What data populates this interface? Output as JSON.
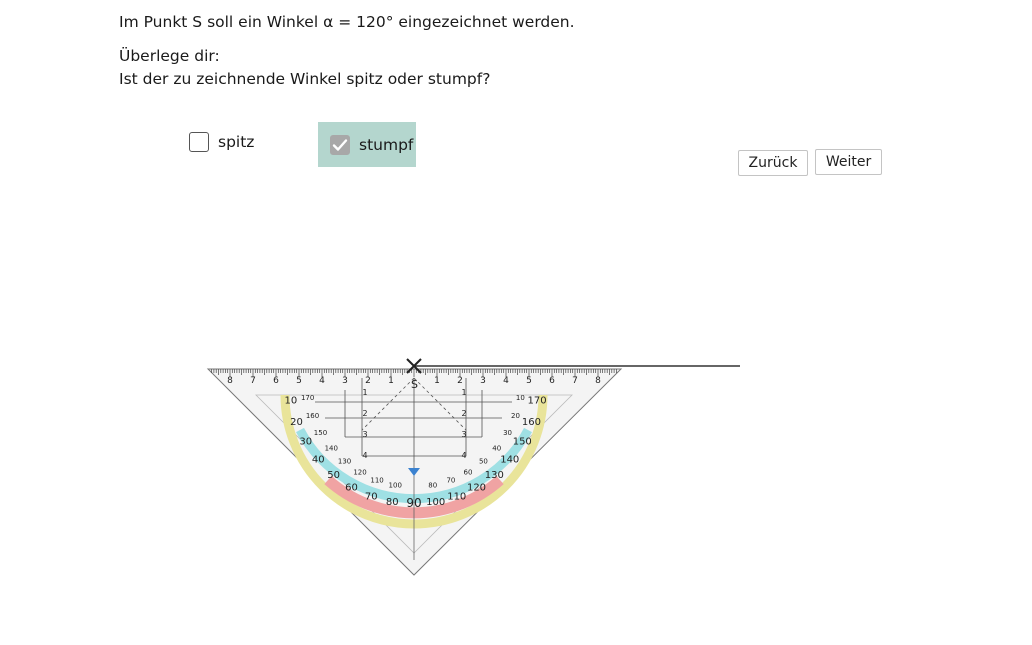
{
  "task": {
    "line1": "Im Punkt S soll ein Winkel α = 120° eingezeichnet werden.",
    "line2": "Überlege dir:",
    "line3": "Ist der zu zeichnende Winkel spitz oder stumpf?"
  },
  "options": [
    {
      "label": "spitz",
      "checked": false
    },
    {
      "label": "stumpf",
      "checked": true
    }
  ],
  "buttons": {
    "back": "Zurück",
    "next": "Weiter"
  },
  "point_label": "S",
  "triangle": {
    "ruler_numbers_left": [
      "8",
      "7",
      "6",
      "5",
      "4",
      "3",
      "2",
      "1"
    ],
    "ruler_numbers_right": [
      "1",
      "2",
      "3",
      "4",
      "5",
      "6",
      "7",
      "8"
    ],
    "inner_numbers": [
      "1",
      "2",
      "3",
      "4"
    ],
    "outer_angle_labels": [
      "10",
      "20",
      "30",
      "40",
      "50",
      "60",
      "70",
      "80",
      "90",
      "100",
      "110",
      "120",
      "130",
      "140",
      "150",
      "160",
      "170"
    ],
    "inner_angle_labels": [
      "170",
      "160",
      "150",
      "140",
      "130",
      "120",
      "110",
      "100",
      "80",
      "70",
      "60",
      "50",
      "40",
      "30",
      "20",
      "10"
    ]
  },
  "colors": {
    "selected_option_bg": "#b4d6ce",
    "checked_box": "#a8a8a8"
  }
}
